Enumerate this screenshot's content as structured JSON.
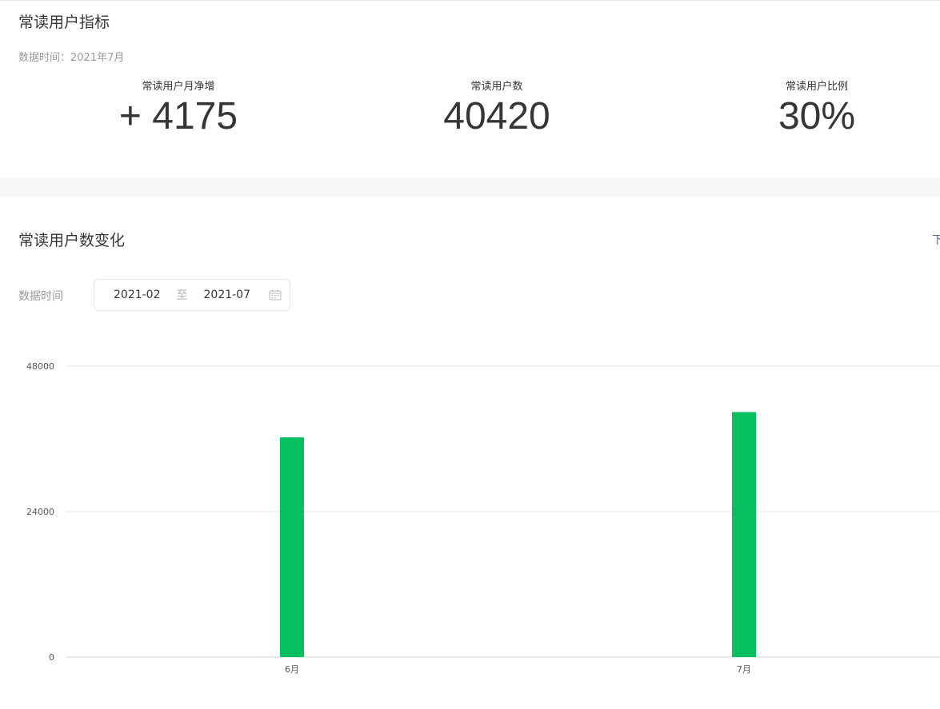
{
  "metrics_panel": {
    "title": "常读用户指标",
    "data_time_label": "数据时间：",
    "data_time_value": "2021年7月",
    "metrics": [
      {
        "label": "常读用户月净增",
        "value": "+ 4175"
      },
      {
        "label": "常读用户数",
        "value": "40420"
      },
      {
        "label": "常读用户比例",
        "value": "30%"
      }
    ]
  },
  "trend_panel": {
    "title": "常读用户数变化",
    "download_label": "下",
    "filter_label": "数据时间",
    "date_start": "2021-02",
    "date_separator": "至",
    "date_end": "2021-07",
    "calendar_icon": "calendar-icon"
  },
  "colors": {
    "bar": "#07c160",
    "grid": "#e6e6e6",
    "page_gap": "#f6f7f9"
  },
  "chart_data": {
    "type": "bar",
    "categories": [
      "6月",
      "7月"
    ],
    "values": [
      36245,
      40420
    ],
    "ylim": [
      0,
      48000
    ],
    "yticks": [
      0,
      24000,
      48000
    ],
    "grid": true,
    "title": "",
    "xlabel": "",
    "ylabel": ""
  }
}
